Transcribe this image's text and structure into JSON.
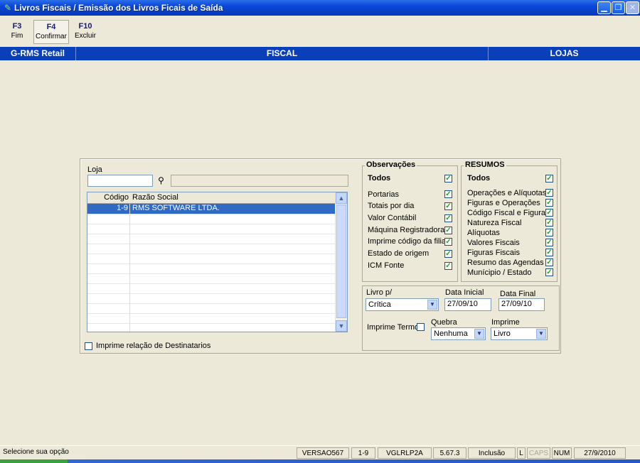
{
  "window": {
    "title": "Livros Fiscais / Emissão dos Livros Ficais de Saída"
  },
  "toolbar": [
    {
      "key": "F3",
      "label": "Fim"
    },
    {
      "key": "F4",
      "label": "Confirmar"
    },
    {
      "key": "F10",
      "label": "Excluir"
    }
  ],
  "modulebar": {
    "app": "G-RMS Retail",
    "module": "FISCAL",
    "area": "LOJAS"
  },
  "loja": {
    "label": "Loja",
    "code_value": "",
    "name_value": "",
    "grid": {
      "headers": [
        "Código",
        "Razão Social"
      ],
      "rows": [
        {
          "code": "1-9",
          "name": "RMS SOFTWARE LTDA."
        }
      ]
    },
    "imprime_destinatarios": "Imprime relação de Destinatarios"
  },
  "observacoes": {
    "title": "Observações",
    "todos": "Todos",
    "items": [
      "Portarias",
      "Totais por dia",
      "Valor Contábil",
      "Máquina Registradora",
      "Imprime código da filial",
      "Estado de origem",
      "ICM Fonte"
    ]
  },
  "resumos": {
    "title": "RESUMOS",
    "todos": "Todos",
    "items": [
      "Operações e Alíquotas",
      "Figuras e Operações",
      "Código Fiscal e Figuras",
      "Natureza Fiscal",
      "Alíquotas",
      "Valores Fiscais",
      "Figuras Fiscais",
      "Resumo das Agendas",
      "Munícipio / Estado"
    ]
  },
  "livro": {
    "livro_label": "Livro p/",
    "livro_value": "Crítica",
    "data_inicial_label": "Data Inicial",
    "data_inicial_value": "27/09/10",
    "data_final_label": "Data Final",
    "data_final_value": "27/09/10",
    "imprime_termo_label": "Imprime Termo",
    "quebra_label": "Quebra",
    "quebra_value": "Nenhuma",
    "imprime_label": "Imprime",
    "imprime_value": "Livro"
  },
  "statusbar": {
    "message": "Selecione sua opção",
    "versao": "VERSAO567",
    "loja": "1-9",
    "program": "VGLRLP2A",
    "version_num": "5.67.3",
    "mode": "Inclusão",
    "l": "L",
    "caps": "CAPS",
    "num": "NUM",
    "date": "27/9/2010"
  }
}
